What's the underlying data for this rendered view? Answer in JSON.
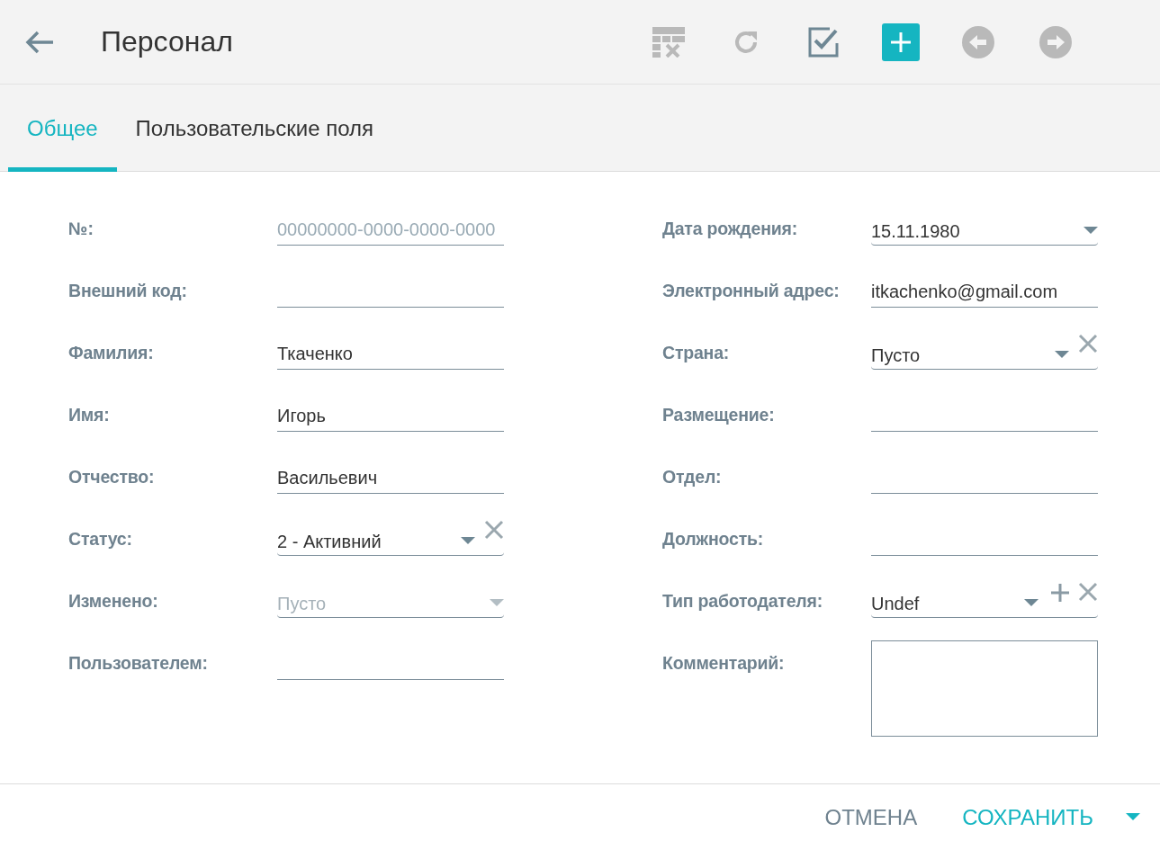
{
  "header": {
    "title": "Персонал"
  },
  "toolbar": [
    {
      "kind": "clear-filter",
      "disabled": true
    },
    {
      "kind": "refresh",
      "disabled": true
    },
    {
      "kind": "check",
      "disabled": false
    },
    {
      "kind": "add",
      "disabled": false
    },
    {
      "kind": "previous",
      "disabled": true
    },
    {
      "kind": "next",
      "disabled": true
    }
  ],
  "tabs": [
    {
      "label": "Общее",
      "selected": true
    },
    {
      "label": "Пользовательские поля",
      "selected": false
    }
  ],
  "left_fields": [
    {
      "label": "№:",
      "kind": "text",
      "placeholder": "00000000-0000-0000-0000"
    },
    {
      "label": "Внешний код:",
      "kind": "text"
    },
    {
      "label": "Фамилия:",
      "kind": "text",
      "value": "Ткаченко"
    },
    {
      "label": "Имя:",
      "kind": "text",
      "value": "Игорь"
    },
    {
      "label": "Отчество:",
      "kind": "text",
      "value": "Васильевич"
    },
    {
      "label": "Статус:",
      "kind": "select",
      "value": "2 - Активний",
      "clearable": true,
      "disabled": false
    },
    {
      "label": "Изменено:",
      "kind": "select",
      "placeholder": "Пусто",
      "disabled": true
    },
    {
      "label": "Пользователем:",
      "kind": "text"
    }
  ],
  "right_fields": [
    {
      "label": "Дата рождения:",
      "kind": "select",
      "value": "15.11.1980",
      "disabled": false
    },
    {
      "label": "Электронный адрес:",
      "kind": "text",
      "value": "itkachenko@gmail.com"
    },
    {
      "label": "Страна:",
      "kind": "select",
      "value": "Пусто",
      "clearable": true,
      "disabled": false
    },
    {
      "label": "Размещение:",
      "kind": "text"
    },
    {
      "label": "Отдел:",
      "kind": "text"
    },
    {
      "label": "Должность:",
      "kind": "text"
    },
    {
      "label": "Тип работодателя:",
      "kind": "select",
      "value": "Undef",
      "addable": true,
      "clearable": true,
      "disabled": false
    },
    {
      "label": "Комментарий:",
      "kind": "textarea"
    }
  ],
  "footer": {
    "cancel": "ОТМЕНА",
    "save": "СОХРАНИТЬ"
  }
}
